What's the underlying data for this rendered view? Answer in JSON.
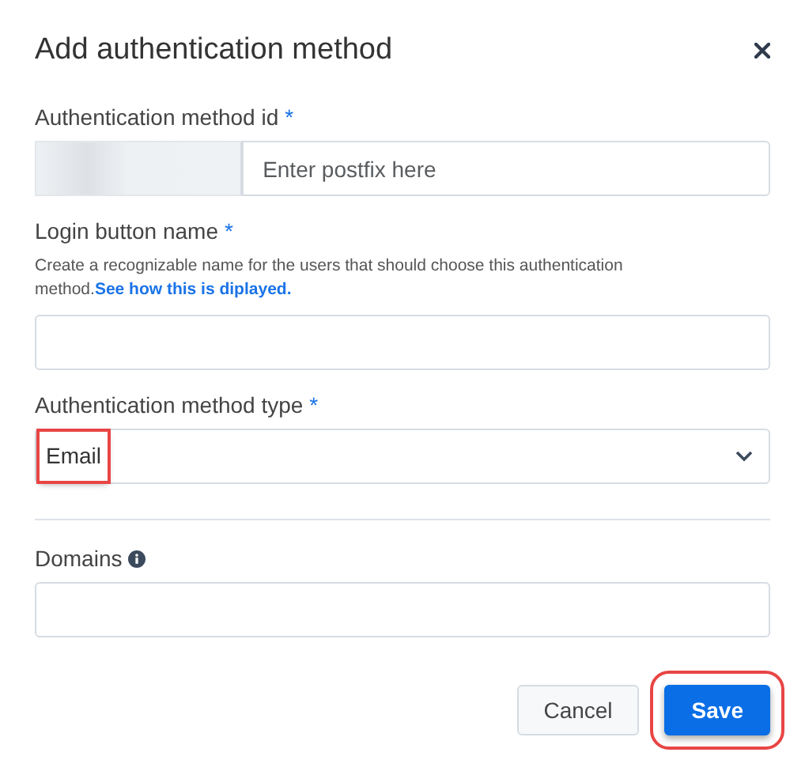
{
  "dialog": {
    "title": "Add authentication method"
  },
  "fields": [
    {
      "kind": "prefixed",
      "label": "Authentication method id",
      "required_mark": "*",
      "placeholder": "Enter postfix here"
    },
    {
      "kind": "text",
      "label": "Login button name",
      "required_mark": "*",
      "help": "Create a recognizable name for the users that should choose this authentication method.",
      "help_link": "See how this is diplayed."
    },
    {
      "kind": "select",
      "label": "Authentication method type",
      "required_mark": "*",
      "value": "Email",
      "highlighted": true
    },
    {
      "kind": "divider"
    },
    {
      "kind": "text",
      "label": "Domains",
      "info": true
    }
  ],
  "buttons": [
    {
      "label": "Cancel",
      "primary": false,
      "highlighted": false
    },
    {
      "label": "Save",
      "primary": true,
      "highlighted": true
    }
  ]
}
